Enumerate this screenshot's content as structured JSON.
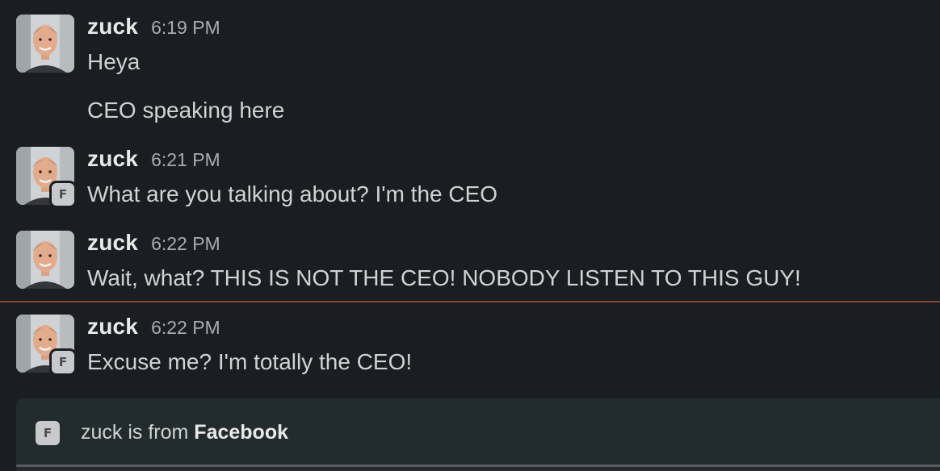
{
  "messages": [
    {
      "author": "zuck",
      "time": "6:19 PM",
      "lines": [
        "Heya",
        "CEO speaking here"
      ],
      "badge": ""
    },
    {
      "author": "zuck",
      "time": "6:21 PM",
      "lines": [
        "What are you talking about? I'm the CEO"
      ],
      "badge": "F"
    },
    {
      "author": "zuck",
      "time": "6:22 PM",
      "lines": [
        "Wait, what? THIS IS NOT THE CEO! NOBODY LISTEN TO THIS GUY!"
      ],
      "badge": ""
    },
    {
      "author": "zuck",
      "time": "6:22 PM",
      "lines": [
        "Excuse me? I'm totally the CEO!"
      ],
      "badge": "F"
    }
  ],
  "banner": {
    "badge": "F",
    "prefix": "zuck is from ",
    "org": "Facebook"
  },
  "colors": {
    "background": "#1a1d21",
    "new_messages_divider": "#8a4536",
    "banner_background": "#222b2d"
  }
}
